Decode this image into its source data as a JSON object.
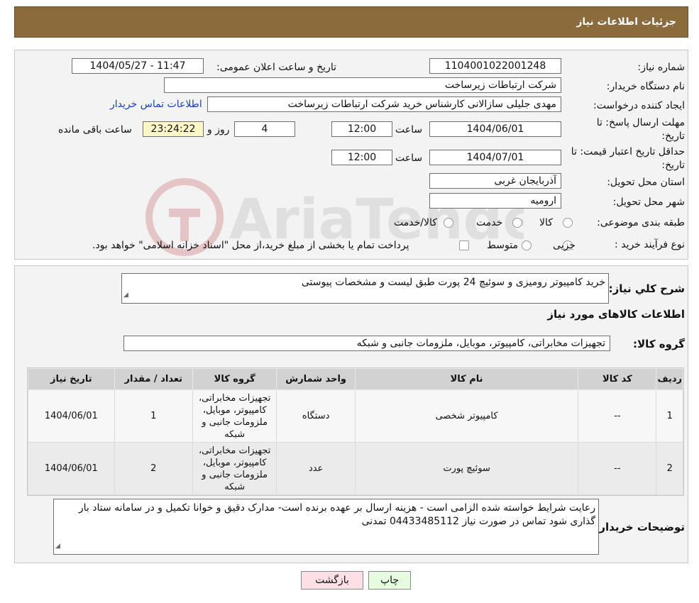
{
  "title": "جزئیات اطلاعات نیاز",
  "watermark": "AriaTender.neT",
  "fields": {
    "need_number_label": "شماره نیاز:",
    "need_number": "1104001022001248",
    "announce_label": "تاریخ و ساعت اعلان عمومی:",
    "announce_value": "1404/05/27 - 11:47",
    "buyer_org_label": "نام دستگاه خریدار:",
    "buyer_org": "شرکت ارتباطات زیرساخت",
    "creator_label": "ایجاد کننده درخواست:",
    "creator": "مهدی جلیلی سازالانی کارشناس خرید شرکت ارتباطات زیرساخت",
    "contact_link": "اطلاعات تماس خریدار",
    "deadline_label_1": "مهلت ارسال پاسخ: تا",
    "deadline_label_2": "تاریخ:",
    "deadline_date": "1404/06/01",
    "time_label": "ساعت",
    "deadline_time": "12:00",
    "days": "4",
    "days_label": "روز و",
    "remaining_time": "23:24:22",
    "remaining_label": "ساعت باقی مانده",
    "validity_label_1": "حداقل تاریخ اعتبار قیمت: تا",
    "validity_label_2": "تاریخ:",
    "validity_date": "1404/07/01",
    "validity_time": "12:00",
    "province_label": "استان محل تحویل:",
    "province": "آذربایجان غربی",
    "city_label": "شهر محل تحویل:",
    "city": "ارومیه",
    "category_label": "طبقه بندی موضوعی:",
    "category_options": [
      "کالا",
      "خدمت",
      "کالا/خدمت"
    ],
    "process_label": "نوع فرآیند خرید :",
    "process_options": [
      "جزیی",
      "متوسط"
    ],
    "process_note": "پرداخت تمام یا بخشی از مبلغ خرید،از محل \"اسناد خزانه اسلامی\" خواهد بود."
  },
  "description": {
    "label": "شرح کلي نیاز:",
    "value": "خرید کامپیوتر رومیزی و سوئیچ 24 پورت طبق لیست و مشخصات پیوستی"
  },
  "goods_info_header": "اطلاعات کالاهای مورد نیاز",
  "goods_group": {
    "label": "گروه کالا:",
    "value": "تجهیزات مخابراتی، کامپیوتر، موبایل، ملزومات جانبی و شبکه"
  },
  "table": {
    "headers": [
      "ردیف",
      "کد کالا",
      "نام کالا",
      "واحد شمارش",
      "گروه کالا",
      "تعداد / مقدار",
      "تاریخ نیاز"
    ],
    "rows": [
      [
        "1",
        "--",
        "کامپیوتر شخصی",
        "دستگاه",
        "تجهیزات مخابراتی، کامپیوتر، موبایل، ملزومات جانبی و شبکه",
        "1",
        "1404/06/01"
      ],
      [
        "2",
        "--",
        "سوئیچ پورت",
        "عدد",
        "تجهیزات مخابراتی، کامپیوتر، موبایل، ملزومات جانبی و شبکه",
        "2",
        "1404/06/01"
      ]
    ]
  },
  "buyer_notes": {
    "label": "توضیحات خریدار:",
    "value": "رعایت شرایط خواسته شده الزامی است - هزینه ارسال بر عهده برنده است- مدارک دقیق و خوانا تکمیل و در سامانه ستاد بار گذاری شود تماس در صورت نیاز 04433485112 تمدنی"
  },
  "buttons": {
    "back": "بازگشت",
    "print": "چاپ"
  }
}
